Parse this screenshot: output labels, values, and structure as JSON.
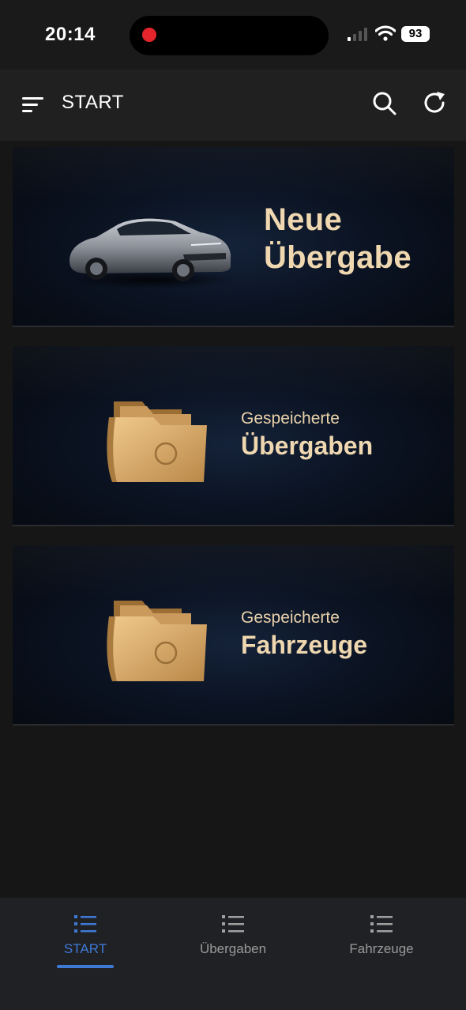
{
  "status_bar": {
    "time": "20:14",
    "battery": "93",
    "icons": [
      "recording-dot-icon",
      "cellular-signal-icon",
      "wifi-icon",
      "battery-icon"
    ]
  },
  "app_bar": {
    "title": "START",
    "icons": [
      "menu-icon",
      "search-icon",
      "refresh-icon"
    ]
  },
  "tiles": [
    {
      "line1": "Neue",
      "line2": "Übergabe",
      "image": "car-image"
    },
    {
      "line1": "Gespeicherte",
      "line2": "Übergaben",
      "image": "folder-image"
    },
    {
      "line1": "Gespeicherte",
      "line2": "Fahrzeuge",
      "image": "folder-image"
    }
  ],
  "bottom_nav": {
    "active_index": 0,
    "accent_color": "#3f79d6",
    "items": [
      {
        "label": "START",
        "icon": "list-icon"
      },
      {
        "label": "Übergaben",
        "icon": "list-icon"
      },
      {
        "label": "Fahrzeuge",
        "icon": "list-icon"
      }
    ]
  }
}
